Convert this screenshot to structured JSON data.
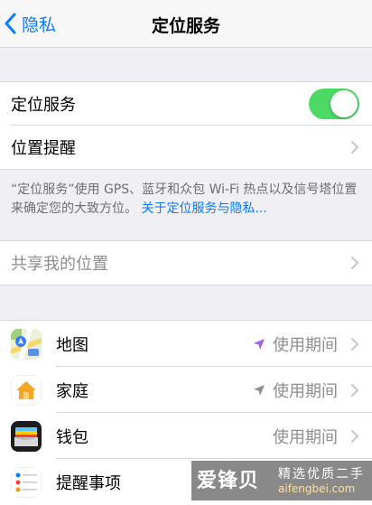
{
  "nav": {
    "back_label": "隐私",
    "title": "定位服务"
  },
  "main": {
    "location_services_label": "定位服务",
    "location_services_on": true,
    "location_alerts_label": "位置提醒",
    "description": "“定位服务”使用 GPS、蓝牙和众包 Wi-Fi 热点以及信号塔位置来确定您的大致方位。",
    "description_link": "关于定位服务与隐私...",
    "share_location_label": "共享我的位置"
  },
  "apps": [
    {
      "name": "地图",
      "status": "使用期间",
      "arrow": "purple",
      "icon": "maps-icon"
    },
    {
      "name": "家庭",
      "status": "使用期间",
      "arrow": "gray",
      "icon": "home-app-icon"
    },
    {
      "name": "钱包",
      "status": "使用期间",
      "arrow": "none",
      "icon": "wallet-icon"
    },
    {
      "name": "提醒事项",
      "status": "",
      "arrow": "none",
      "icon": "reminders-icon"
    }
  ],
  "watermark": {
    "brand": "爱锋贝",
    "slogan": "精选优质二手",
    "url": "aifengbei.com"
  },
  "colors": {
    "accent": "#0a7aff",
    "toggle_on": "#4cd964",
    "arrow_purple": "#a35fe0",
    "arrow_gray": "#8e8e93"
  }
}
